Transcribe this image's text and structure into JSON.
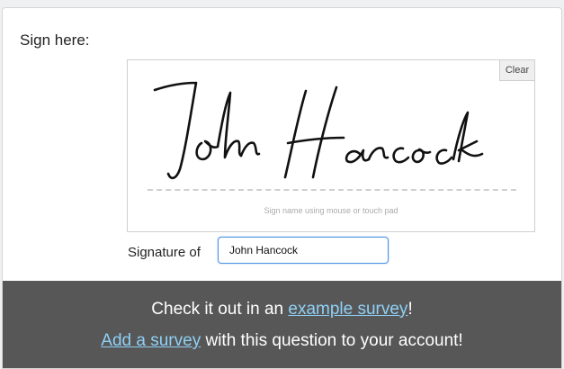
{
  "question": {
    "title": "Sign here:"
  },
  "signature_pad": {
    "clear_label": "Clear",
    "hint": "Sign name using mouse or touch pad",
    "signature_text": "John Hancock"
  },
  "signature_of": {
    "label": "Signature of",
    "value": "John Hancock"
  },
  "footer": {
    "line1_prefix": "Check it out in an ",
    "line1_link": "example survey",
    "line1_suffix": "!",
    "line2_link": "Add a survey",
    "line2_suffix": " with this question to your account!"
  },
  "colors": {
    "footer_bg": "#575757",
    "link": "#8fd0f5",
    "input_border": "#4a90e2"
  }
}
